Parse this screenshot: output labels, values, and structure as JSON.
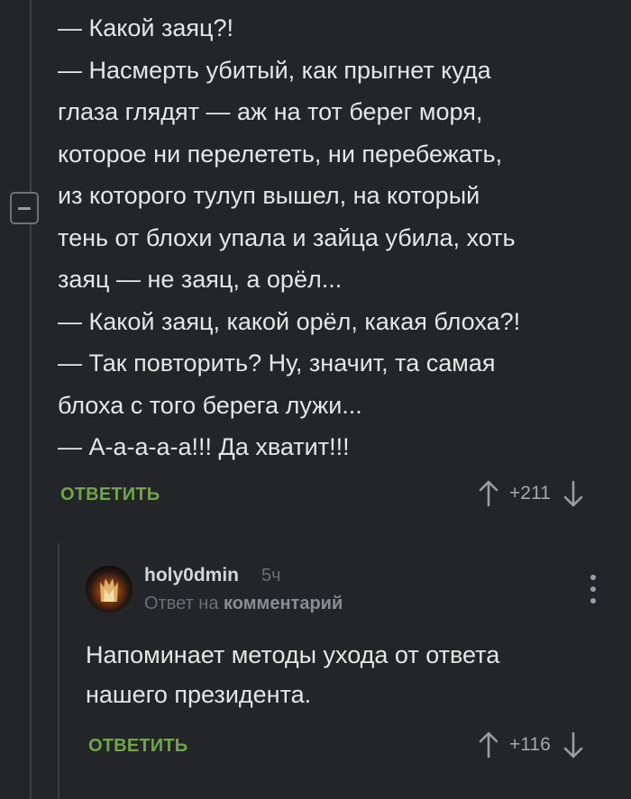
{
  "parent_comment": {
    "lines": [
      "— Какой заяц?!",
      "— Насмерть убитый, как прыгнет куда",
      "глаза глядят — аж на тот берег моря,",
      "которое ни перелететь, ни перебежать,",
      "из которого тулуп вышел, на который",
      "тень от блохи упала и зайца убила, хоть",
      "заяц — не заяц, а орёл...",
      "— Какой заяц, какой орёл, какая блоха?!",
      "— Так повторить? Ну, значит, та самая",
      "блоха с того берега лужи...",
      "— А-а-а-а-а!!! Да хватит!!!"
    ],
    "reply_label": "ОТВЕТИТЬ",
    "score": "+211",
    "upvote_icon": "arrow-up-icon",
    "downvote_icon": "arrow-down-icon",
    "collapse_icon": "minus-box-icon"
  },
  "reply_comment": {
    "username": "holy0dmin",
    "time": "5ч",
    "reply_to_prefix": "Ответ на",
    "reply_to_target": "комментарий",
    "text_lines": [
      "Напоминает методы ухода от ответа",
      "нашего президента."
    ],
    "reply_label": "ОТВЕТИТЬ",
    "score": "+116",
    "more_icon": "vertical-dots-icon"
  },
  "colors": {
    "background": "#232528",
    "text": "#e6e6e6",
    "accent_green": "#6fa64a",
    "muted": "#6c7075",
    "thread_line": "#3b3d40"
  }
}
